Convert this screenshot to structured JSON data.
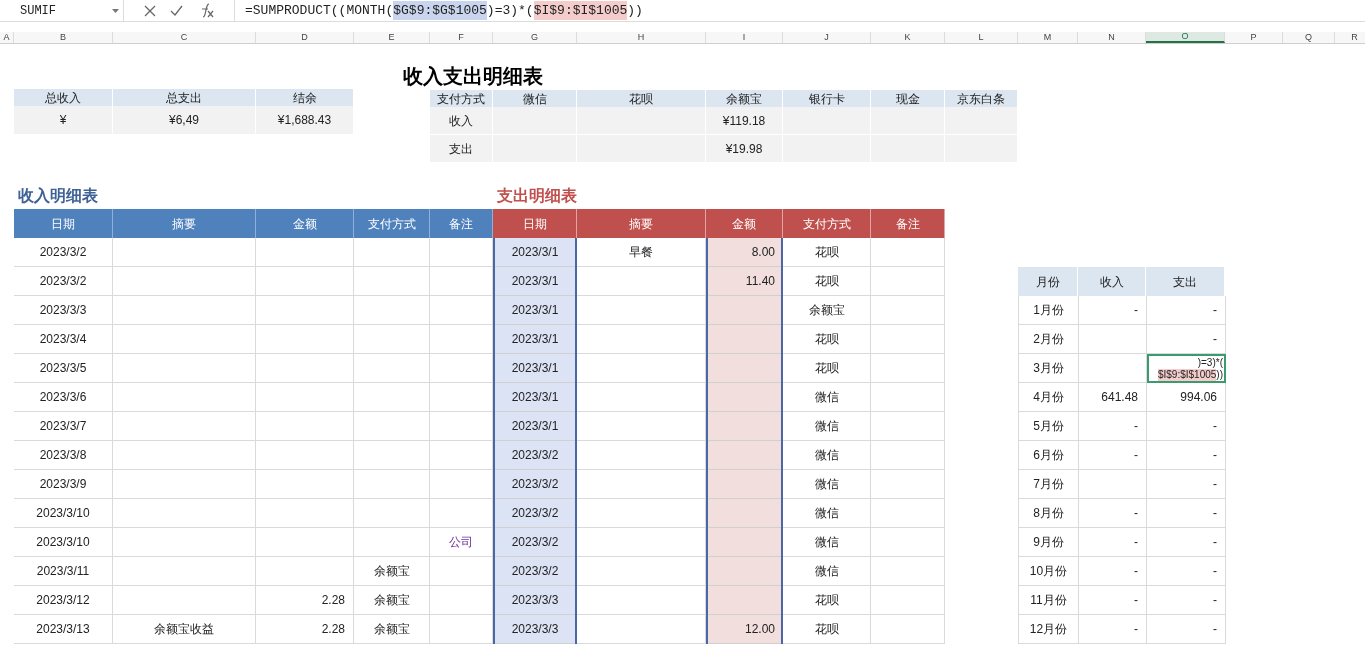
{
  "formula_bar": {
    "name_box": "SUMIF",
    "formula": [
      {
        "text": "=SUMPRODUCT((MONTH("
      },
      {
        "text": "$G$9:$G$1005",
        "color": "#c9d5ee"
      },
      {
        "text": ")=3)*("
      },
      {
        "text": "$I$9:$I$1005",
        "color": "#f4cccc"
      },
      {
        "text": "))"
      }
    ]
  },
  "column_headers": [
    {
      "label": "A",
      "selected": false
    },
    {
      "label": "B",
      "selected": false
    },
    {
      "label": "C",
      "selected": false
    },
    {
      "label": "D",
      "selected": false
    },
    {
      "label": "E",
      "selected": false
    },
    {
      "label": "F",
      "selected": false
    },
    {
      "label": "G",
      "selected": false
    },
    {
      "label": "H",
      "selected": false
    },
    {
      "label": "I",
      "selected": false
    },
    {
      "label": "J",
      "selected": false
    },
    {
      "label": "K",
      "selected": false
    },
    {
      "label": "L",
      "selected": false
    },
    {
      "label": "M",
      "selected": false
    },
    {
      "label": "N",
      "selected": false
    },
    {
      "label": "O",
      "selected": true
    },
    {
      "label": "P",
      "selected": false
    },
    {
      "label": "Q",
      "selected": false
    },
    {
      "label": "R",
      "selected": false
    }
  ],
  "title": "收入支出明细表",
  "summary": {
    "headers": [
      "总收入",
      "总支出",
      "结余"
    ],
    "values": [
      "¥",
      "¥6,49",
      "¥1,688.43"
    ]
  },
  "payment_table": {
    "headers": [
      "支付方式",
      "微信",
      "花呗",
      "余额宝",
      "银行卡",
      "现金",
      "京东白条"
    ],
    "rows": [
      {
        "label": "收入",
        "yuebao": "¥119.18"
      },
      {
        "label": "支出",
        "yuebao": "¥19.98"
      }
    ]
  },
  "income_table": {
    "title": "收入明细表",
    "columns": [
      "日期",
      "摘要",
      "金额",
      "支付方式",
      "备注"
    ],
    "rows": [
      {
        "date": "2023/3/2"
      },
      {
        "date": "2023/3/2"
      },
      {
        "date": "2023/3/3"
      },
      {
        "date": "2023/3/4"
      },
      {
        "date": "2023/3/5"
      },
      {
        "date": "2023/3/6"
      },
      {
        "date": "2023/3/7"
      },
      {
        "date": "2023/3/8"
      },
      {
        "date": "2023/3/9"
      },
      {
        "date": "2023/3/10"
      },
      {
        "date": "2023/3/10",
        "note": "公司"
      },
      {
        "date": "2023/3/11",
        "payment": "余额宝"
      },
      {
        "date": "2023/3/12",
        "amount": "2.28",
        "payment": "余额宝"
      },
      {
        "date": "2023/3/13",
        "summary": "余额宝收益",
        "amount": "2.28",
        "payment": "余额宝"
      }
    ]
  },
  "expense_table": {
    "title": "支出明细表",
    "columns": [
      {
        "label": "日期",
        "color": "#dbe3f5"
      },
      {
        "label": "摘要"
      },
      {
        "label": "金额",
        "color": "#f3dede"
      },
      {
        "label": "支付方式"
      },
      {
        "label": "备注"
      }
    ],
    "rows": [
      {
        "date": "2023/3/1",
        "summary": "早餐",
        "amount": "8.00",
        "payment": "花呗"
      },
      {
        "date": "2023/3/1",
        "amount": "11.40",
        "payment": "花呗"
      },
      {
        "date": "2023/3/1",
        "payment": "余额宝"
      },
      {
        "date": "2023/3/1",
        "payment": "花呗"
      },
      {
        "date": "2023/3/1",
        "payment": "花呗"
      },
      {
        "date": "2023/3/1",
        "payment": "微信"
      },
      {
        "date": "2023/3/1",
        "payment": "微信"
      },
      {
        "date": "2023/3/2",
        "payment": "微信"
      },
      {
        "date": "2023/3/2",
        "payment": "微信"
      },
      {
        "date": "2023/3/2",
        "payment": "微信"
      },
      {
        "date": "2023/3/2",
        "payment": "微信"
      },
      {
        "date": "2023/3/2",
        "payment": "微信"
      },
      {
        "date": "2023/3/3",
        "payment": "花呗"
      },
      {
        "date": "2023/3/3",
        "amount": "12.00",
        "payment": "花呗"
      }
    ]
  },
  "month_table": {
    "headers": [
      "月份",
      "收入",
      "支出"
    ],
    "rows": [
      {
        "month": "1月份",
        "income": "-",
        "expense": "-",
        "editing": false
      },
      {
        "month": "2月份",
        "expense": "-",
        "editing": false
      },
      {
        "month": "3月份",
        "editing": true,
        "edit_text": [
          {
            "text": ")=3)*("
          },
          {
            "text": "$I$9:$I$1005",
            "color": "#f4cccc"
          },
          {
            "text": "))"
          }
        ]
      },
      {
        "month": "4月份",
        "income": "641.48",
        "expense": "994.06",
        "editing": false
      },
      {
        "month": "5月份",
        "income": "-",
        "expense": "-",
        "editing": false
      },
      {
        "month": "6月份",
        "income": "-",
        "expense": "-",
        "editing": false
      },
      {
        "month": "7月份",
        "expense": "-",
        "editing": false
      },
      {
        "month": "8月份",
        "income": "-",
        "expense": "-",
        "editing": false
      },
      {
        "month": "9月份",
        "income": "-",
        "expense": "-",
        "editing": false
      },
      {
        "month": "10月份",
        "income": "-",
        "expense": "-",
        "editing": false
      },
      {
        "month": "11月份",
        "income": "-",
        "expense": "-",
        "editing": false
      },
      {
        "month": "12月份",
        "income": "-",
        "expense": "-",
        "editing": false
      }
    ]
  }
}
